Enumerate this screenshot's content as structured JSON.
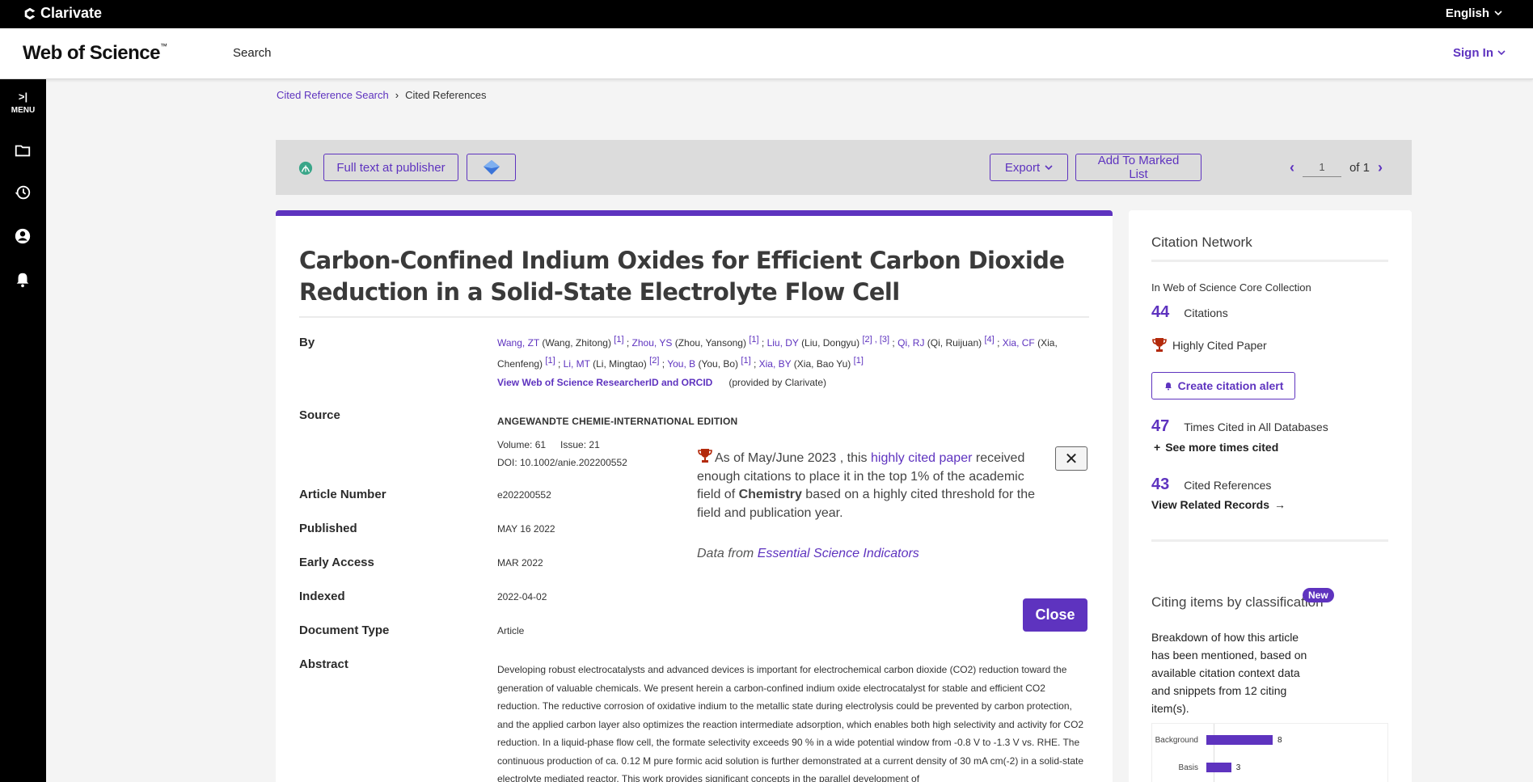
{
  "topbar": {
    "brand": "Clarivate",
    "language": "English"
  },
  "header": {
    "logo": "Web of Science",
    "logo_tm": "™",
    "nav_search": "Search",
    "sign_in": "Sign In"
  },
  "sidebar": {
    "menu_label": "MENU",
    "icons": [
      "folder-icon",
      "history-icon",
      "account-icon",
      "bell-icon"
    ]
  },
  "breadcrumb": {
    "parent": "Cited Reference Search",
    "separator": "›",
    "current": "Cited References"
  },
  "toolbar": {
    "full_text": "Full text at publisher",
    "export": "Export",
    "add_marked": "Add To Marked List",
    "page_value": "1",
    "page_of": "of 1"
  },
  "record": {
    "title": "Carbon-Confined Indium Oxides for Efficient Carbon Dioxide Reduction in a Solid-State Electrolyte Flow Cell",
    "labels": {
      "by": "By",
      "source": "Source",
      "article_number": "Article Number",
      "published": "Published",
      "early_access": "Early Access",
      "indexed": "Indexed",
      "document_type": "Document Type",
      "abstract": "Abstract"
    },
    "authors": [
      {
        "short": "Wang, ZT",
        "full": "(Wang, Zhitong)",
        "aff": "[1]"
      },
      {
        "short": "Zhou, YS",
        "full": "(Zhou, Yansong)",
        "aff": "[1]"
      },
      {
        "short": "Liu, DY",
        "full": "(Liu, Dongyu)",
        "aff": "[2] , [3]"
      },
      {
        "short": "Qi, RJ",
        "full": "(Qi, Ruijuan)",
        "aff": "[4]"
      },
      {
        "short": "Xia, CF",
        "full": "(Xia, Chenfeng)",
        "aff": "[1]"
      },
      {
        "short": "Li, MT",
        "full": "(Li, Mingtao)",
        "aff": "[2]"
      },
      {
        "short": "You, B",
        "full": "(You, Bo)",
        "aff": "[1]"
      },
      {
        "short": "Xia, BY",
        "full": "(Xia, Bao Yu)",
        "aff": "[1]"
      }
    ],
    "author_sep": " ; ",
    "researcher_link": "View Web of Science ResearcherID and ORCID",
    "provided_by": "(provided by Clarivate)",
    "source": "ANGEWANDTE CHEMIE-INTERNATIONAL EDITION",
    "volume": "Volume: 61",
    "issue": "Issue: 21",
    "doi": "DOI: 10.1002/anie.202200552",
    "article_number": "e202200552",
    "published": "MAY 16 2022",
    "early_access": "MAR 2022",
    "indexed": "2022-04-02",
    "document_type": "Article",
    "abstract": "Developing robust electrocatalysts and advanced devices is important for electrochemical carbon dioxide (CO2) reduction toward the generation of valuable chemicals. We present herein a carbon-confined indium oxide electrocatalyst for stable and efficient CO2 reduction. The reductive corrosion of oxidative indium to the metallic state during electrolysis could be prevented by carbon protection, and the applied carbon layer also optimizes the reaction intermediate adsorption, which enables both high selectivity and activity for CO2 reduction. In a liquid-phase flow cell, the formate selectivity exceeds 90 % in a wide potential window from -0.8 V to -1.3 V vs. RHE. The continuous production of ca. 0.12 M pure formic acid solution is further demonstrated at a current density of 30 mA cm(-2) in a solid-state electrolyte mediated reactor. This work provides significant concepts in the parallel development of"
  },
  "popover": {
    "intro": "As of May/June 2023 , this ",
    "link": "highly cited paper",
    "mid": " received enough citations to place it in the top 1% of the academic field of ",
    "field": "Chemistry",
    "end": " based on a highly cited threshold for the field and publication year.",
    "data_from": "Data from ",
    "esi_link": "Essential Science Indicators",
    "close_x": "✕",
    "close_label": "Close"
  },
  "citation_network": {
    "title": "Citation Network",
    "subtitle": "In Web of Science Core Collection",
    "citations_num": "44",
    "citations_label": "Citations",
    "highly_cited": "Highly Cited Paper",
    "create_alert": "Create citation alert",
    "times_cited_num": "47",
    "times_cited_label": "Times Cited in All Databases",
    "see_more": "See more times cited",
    "cited_refs_num": "43",
    "cited_refs_label": "Cited References",
    "related": "View Related Records",
    "cic_title": "Citing items by classification",
    "new_badge": "New",
    "cic_desc": "Breakdown of how this article has been mentioned, based on available citation context data and snippets from 12 citing item(s).",
    "classification": [
      {
        "label": "Background",
        "count": 8
      },
      {
        "label": "Basis",
        "count": 3
      }
    ]
  },
  "colors": {
    "accent": "#5e33bf",
    "trophy": "#b32a0c"
  }
}
